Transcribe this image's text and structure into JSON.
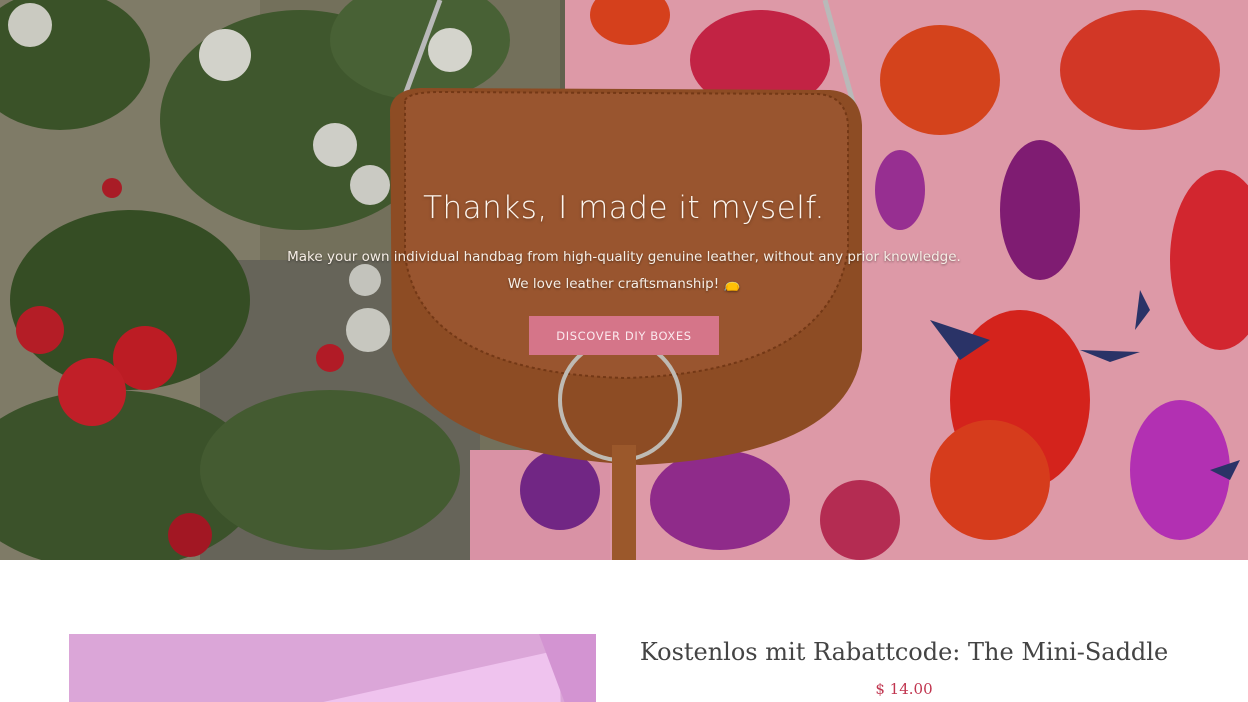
{
  "hero": {
    "title": "Thanks, I made it myself.",
    "subtitle_line1": "Make your own individual handbag from high-quality genuine leather, without any prior knowledge.",
    "subtitle_line2": "We love leather craftsmanship! 👝",
    "cta_label": "DISCOVER DIY BOXES"
  },
  "product": {
    "title": "Kostenlos mit Rabattcode: The Mini-Saddle",
    "price": "$ 14.00"
  },
  "colors": {
    "cta_background": "#d57589",
    "price_text": "#c0354f",
    "product_image_background": "#dba6d8"
  }
}
